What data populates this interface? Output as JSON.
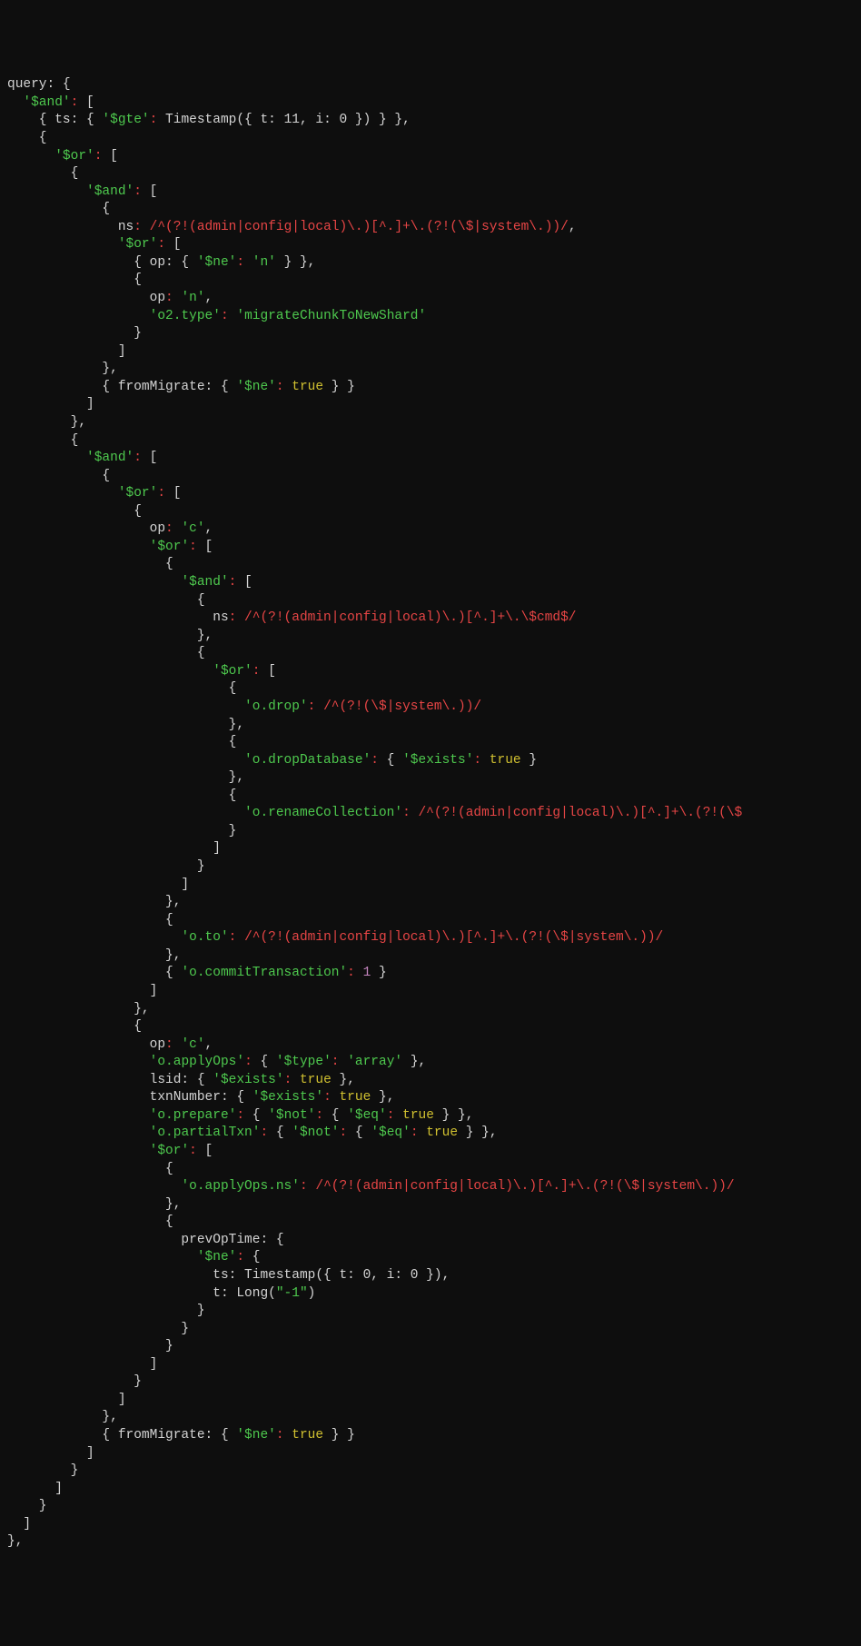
{
  "tokens": [
    [
      "w",
      "query: {"
    ],
    [
      "nl"
    ],
    [
      "w",
      "  "
    ],
    [
      "g",
      "'$and'"
    ],
    [
      "r",
      ":"
    ],
    [
      "w",
      " ["
    ],
    [
      "nl"
    ],
    [
      "w",
      "    { ts: { "
    ],
    [
      "g",
      "'$gte'"
    ],
    [
      "r",
      ":"
    ],
    [
      "w",
      " Timestamp({ t: 11, i: 0 }) } },"
    ],
    [
      "nl"
    ],
    [
      "w",
      "    {"
    ],
    [
      "nl"
    ],
    [
      "w",
      "      "
    ],
    [
      "g",
      "'$or'"
    ],
    [
      "r",
      ":"
    ],
    [
      "w",
      " ["
    ],
    [
      "nl"
    ],
    [
      "w",
      "        {"
    ],
    [
      "nl"
    ],
    [
      "w",
      "          "
    ],
    [
      "g",
      "'$and'"
    ],
    [
      "r",
      ":"
    ],
    [
      "w",
      " ["
    ],
    [
      "nl"
    ],
    [
      "w",
      "            {"
    ],
    [
      "nl"
    ],
    [
      "w",
      "              ns"
    ],
    [
      "r",
      ":"
    ],
    [
      "w",
      " "
    ],
    [
      "r",
      "/^(?!(admin|config|local)\\.)[^.]+\\.(?!(\\$|system\\.))/"
    ],
    [
      "w",
      ","
    ],
    [
      "nl"
    ],
    [
      "w",
      "              "
    ],
    [
      "g",
      "'$or'"
    ],
    [
      "r",
      ":"
    ],
    [
      "w",
      " ["
    ],
    [
      "nl"
    ],
    [
      "w",
      "                { op: { "
    ],
    [
      "g",
      "'$ne'"
    ],
    [
      "r",
      ":"
    ],
    [
      "w",
      " "
    ],
    [
      "g",
      "'n'"
    ],
    [
      "w",
      " } },"
    ],
    [
      "nl"
    ],
    [
      "w",
      "                {"
    ],
    [
      "nl"
    ],
    [
      "w",
      "                  op"
    ],
    [
      "r",
      ":"
    ],
    [
      "w",
      " "
    ],
    [
      "g",
      "'n'"
    ],
    [
      "w",
      ","
    ],
    [
      "nl"
    ],
    [
      "w",
      "                  "
    ],
    [
      "g",
      "'o2.type'"
    ],
    [
      "r",
      ":"
    ],
    [
      "w",
      " "
    ],
    [
      "g",
      "'migrateChunkToNewShard'"
    ],
    [
      "nl"
    ],
    [
      "w",
      "                }"
    ],
    [
      "nl"
    ],
    [
      "w",
      "              ]"
    ],
    [
      "nl"
    ],
    [
      "w",
      "            },"
    ],
    [
      "nl"
    ],
    [
      "w",
      "            { fromMigrate: { "
    ],
    [
      "g",
      "'$ne'"
    ],
    [
      "r",
      ":"
    ],
    [
      "w",
      " "
    ],
    [
      "y",
      "true"
    ],
    [
      "w",
      " } }"
    ],
    [
      "nl"
    ],
    [
      "w",
      "          ]"
    ],
    [
      "nl"
    ],
    [
      "w",
      "        },"
    ],
    [
      "nl"
    ],
    [
      "w",
      "        {"
    ],
    [
      "nl"
    ],
    [
      "w",
      "          "
    ],
    [
      "g",
      "'$and'"
    ],
    [
      "r",
      ":"
    ],
    [
      "w",
      " ["
    ],
    [
      "nl"
    ],
    [
      "w",
      "            {"
    ],
    [
      "nl"
    ],
    [
      "w",
      "              "
    ],
    [
      "g",
      "'$or'"
    ],
    [
      "r",
      ":"
    ],
    [
      "w",
      " ["
    ],
    [
      "nl"
    ],
    [
      "w",
      "                {"
    ],
    [
      "nl"
    ],
    [
      "w",
      "                  op"
    ],
    [
      "r",
      ":"
    ],
    [
      "w",
      " "
    ],
    [
      "g",
      "'c'"
    ],
    [
      "w",
      ","
    ],
    [
      "nl"
    ],
    [
      "w",
      "                  "
    ],
    [
      "g",
      "'$or'"
    ],
    [
      "r",
      ":"
    ],
    [
      "w",
      " ["
    ],
    [
      "nl"
    ],
    [
      "w",
      "                    {"
    ],
    [
      "nl"
    ],
    [
      "w",
      "                      "
    ],
    [
      "g",
      "'$and'"
    ],
    [
      "r",
      ":"
    ],
    [
      "w",
      " ["
    ],
    [
      "nl"
    ],
    [
      "w",
      "                        {"
    ],
    [
      "nl"
    ],
    [
      "w",
      "                          ns"
    ],
    [
      "r",
      ":"
    ],
    [
      "w",
      " "
    ],
    [
      "r",
      "/^(?!(admin|config|local)\\.)[^.]+\\.\\$cmd$/"
    ],
    [
      "nl"
    ],
    [
      "w",
      "                        },"
    ],
    [
      "nl"
    ],
    [
      "w",
      "                        {"
    ],
    [
      "nl"
    ],
    [
      "w",
      "                          "
    ],
    [
      "g",
      "'$or'"
    ],
    [
      "r",
      ":"
    ],
    [
      "w",
      " ["
    ],
    [
      "nl"
    ],
    [
      "w",
      "                            {"
    ],
    [
      "nl"
    ],
    [
      "w",
      "                              "
    ],
    [
      "g",
      "'o.drop'"
    ],
    [
      "r",
      ":"
    ],
    [
      "w",
      " "
    ],
    [
      "r",
      "/^(?!(\\$|system\\.))/"
    ],
    [
      "nl"
    ],
    [
      "w",
      "                            },"
    ],
    [
      "nl"
    ],
    [
      "w",
      "                            {"
    ],
    [
      "nl"
    ],
    [
      "w",
      "                              "
    ],
    [
      "g",
      "'o.dropDatabase'"
    ],
    [
      "r",
      ":"
    ],
    [
      "w",
      " { "
    ],
    [
      "g",
      "'$exists'"
    ],
    [
      "r",
      ":"
    ],
    [
      "w",
      " "
    ],
    [
      "y",
      "true"
    ],
    [
      "w",
      " }"
    ],
    [
      "nl"
    ],
    [
      "w",
      "                            },"
    ],
    [
      "nl"
    ],
    [
      "w",
      "                            {"
    ],
    [
      "nl"
    ],
    [
      "w",
      "                              "
    ],
    [
      "g",
      "'o.renameCollection'"
    ],
    [
      "r",
      ":"
    ],
    [
      "w",
      " "
    ],
    [
      "r",
      "/^(?!(admin|config|local)\\.)[^.]+\\.(?!(\\$"
    ],
    [
      "nl"
    ],
    [
      "w",
      "                            }"
    ],
    [
      "nl"
    ],
    [
      "w",
      "                          ]"
    ],
    [
      "nl"
    ],
    [
      "w",
      "                        }"
    ],
    [
      "nl"
    ],
    [
      "w",
      "                      ]"
    ],
    [
      "nl"
    ],
    [
      "w",
      "                    },"
    ],
    [
      "nl"
    ],
    [
      "w",
      "                    {"
    ],
    [
      "nl"
    ],
    [
      "w",
      "                      "
    ],
    [
      "g",
      "'o.to'"
    ],
    [
      "r",
      ":"
    ],
    [
      "w",
      " "
    ],
    [
      "r",
      "/^(?!(admin|config|local)\\.)[^.]+\\.(?!(\\$|system\\.))/"
    ],
    [
      "nl"
    ],
    [
      "w",
      "                    },"
    ],
    [
      "nl"
    ],
    [
      "w",
      "                    { "
    ],
    [
      "g",
      "'o.commitTransaction'"
    ],
    [
      "r",
      ":"
    ],
    [
      "w",
      " "
    ],
    [
      "p",
      "1"
    ],
    [
      "w",
      " }"
    ],
    [
      "nl"
    ],
    [
      "w",
      "                  ]"
    ],
    [
      "nl"
    ],
    [
      "w",
      "                },"
    ],
    [
      "nl"
    ],
    [
      "w",
      "                {"
    ],
    [
      "nl"
    ],
    [
      "w",
      "                  op"
    ],
    [
      "r",
      ":"
    ],
    [
      "w",
      " "
    ],
    [
      "g",
      "'c'"
    ],
    [
      "w",
      ","
    ],
    [
      "nl"
    ],
    [
      "w",
      "                  "
    ],
    [
      "g",
      "'o.applyOps'"
    ],
    [
      "r",
      ":"
    ],
    [
      "w",
      " { "
    ],
    [
      "g",
      "'$type'"
    ],
    [
      "r",
      ":"
    ],
    [
      "w",
      " "
    ],
    [
      "g",
      "'array'"
    ],
    [
      "w",
      " },"
    ],
    [
      "nl"
    ],
    [
      "w",
      "                  lsid: { "
    ],
    [
      "g",
      "'$exists'"
    ],
    [
      "r",
      ":"
    ],
    [
      "w",
      " "
    ],
    [
      "y",
      "true"
    ],
    [
      "w",
      " },"
    ],
    [
      "nl"
    ],
    [
      "w",
      "                  txnNumber: { "
    ],
    [
      "g",
      "'$exists'"
    ],
    [
      "r",
      ":"
    ],
    [
      "w",
      " "
    ],
    [
      "y",
      "true"
    ],
    [
      "w",
      " },"
    ],
    [
      "nl"
    ],
    [
      "w",
      "                  "
    ],
    [
      "g",
      "'o.prepare'"
    ],
    [
      "r",
      ":"
    ],
    [
      "w",
      " { "
    ],
    [
      "g",
      "'$not'"
    ],
    [
      "r",
      ":"
    ],
    [
      "w",
      " { "
    ],
    [
      "g",
      "'$eq'"
    ],
    [
      "r",
      ":"
    ],
    [
      "w",
      " "
    ],
    [
      "y",
      "true"
    ],
    [
      "w",
      " } },"
    ],
    [
      "nl"
    ],
    [
      "w",
      "                  "
    ],
    [
      "g",
      "'o.partialTxn'"
    ],
    [
      "r",
      ":"
    ],
    [
      "w",
      " { "
    ],
    [
      "g",
      "'$not'"
    ],
    [
      "r",
      ":"
    ],
    [
      "w",
      " { "
    ],
    [
      "g",
      "'$eq'"
    ],
    [
      "r",
      ":"
    ],
    [
      "w",
      " "
    ],
    [
      "y",
      "true"
    ],
    [
      "w",
      " } },"
    ],
    [
      "nl"
    ],
    [
      "w",
      "                  "
    ],
    [
      "g",
      "'$or'"
    ],
    [
      "r",
      ":"
    ],
    [
      "w",
      " ["
    ],
    [
      "nl"
    ],
    [
      "w",
      "                    {"
    ],
    [
      "nl"
    ],
    [
      "w",
      "                      "
    ],
    [
      "g",
      "'o.applyOps.ns'"
    ],
    [
      "r",
      ":"
    ],
    [
      "w",
      " "
    ],
    [
      "r",
      "/^(?!(admin|config|local)\\.)[^.]+\\.(?!(\\$|system\\.))/"
    ],
    [
      "nl"
    ],
    [
      "w",
      "                    },"
    ],
    [
      "nl"
    ],
    [
      "w",
      "                    {"
    ],
    [
      "nl"
    ],
    [
      "w",
      "                      prevOpTime: {"
    ],
    [
      "nl"
    ],
    [
      "w",
      "                        "
    ],
    [
      "g",
      "'$ne'"
    ],
    [
      "r",
      ":"
    ],
    [
      "w",
      " {"
    ],
    [
      "nl"
    ],
    [
      "w",
      "                          ts: Timestamp({ t: 0, i: 0 }),"
    ],
    [
      "nl"
    ],
    [
      "w",
      "                          t: Long("
    ],
    [
      "g",
      "\"-1\""
    ],
    [
      "w",
      ")"
    ],
    [
      "nl"
    ],
    [
      "w",
      "                        }"
    ],
    [
      "nl"
    ],
    [
      "w",
      "                      }"
    ],
    [
      "nl"
    ],
    [
      "w",
      "                    }"
    ],
    [
      "nl"
    ],
    [
      "w",
      "                  ]"
    ],
    [
      "nl"
    ],
    [
      "w",
      "                }"
    ],
    [
      "nl"
    ],
    [
      "w",
      "              ]"
    ],
    [
      "nl"
    ],
    [
      "w",
      "            },"
    ],
    [
      "nl"
    ],
    [
      "w",
      "            { fromMigrate: { "
    ],
    [
      "g",
      "'$ne'"
    ],
    [
      "r",
      ":"
    ],
    [
      "w",
      " "
    ],
    [
      "y",
      "true"
    ],
    [
      "w",
      " } }"
    ],
    [
      "nl"
    ],
    [
      "w",
      "          ]"
    ],
    [
      "nl"
    ],
    [
      "w",
      "        }"
    ],
    [
      "nl"
    ],
    [
      "w",
      "      ]"
    ],
    [
      "nl"
    ],
    [
      "w",
      "    }"
    ],
    [
      "nl"
    ],
    [
      "w",
      "  ]"
    ],
    [
      "nl"
    ],
    [
      "w",
      "},"
    ]
  ]
}
